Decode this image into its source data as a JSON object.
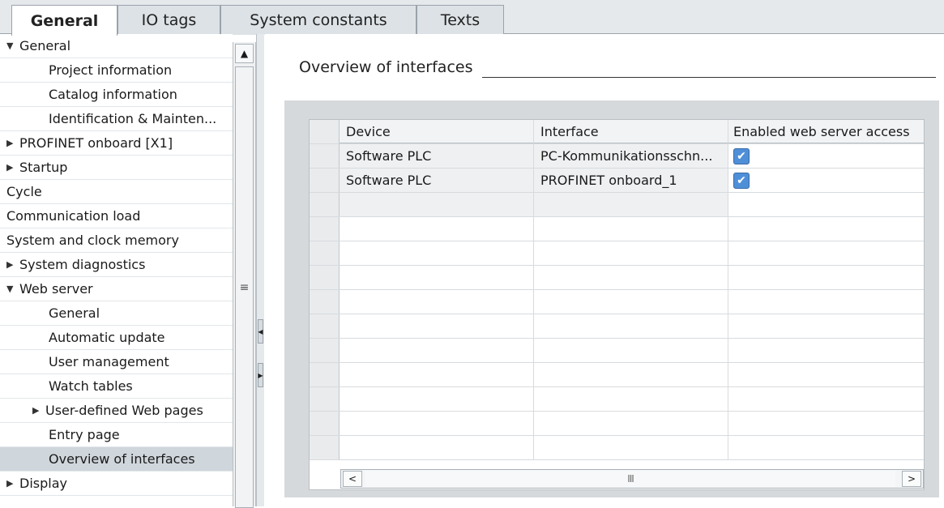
{
  "tabs": [
    {
      "label": "General",
      "active": true
    },
    {
      "label": "IO tags",
      "active": false
    },
    {
      "label": "System constants",
      "active": false
    },
    {
      "label": "Texts",
      "active": false
    }
  ],
  "tree": [
    {
      "label": "General",
      "expander": "▼",
      "selected": false
    },
    {
      "label": "Project information",
      "expander": "",
      "selected": false
    },
    {
      "label": "Catalog information",
      "expander": "",
      "selected": false
    },
    {
      "label": "Identification & Mainten...",
      "expander": "",
      "selected": false
    },
    {
      "label": "PROFINET onboard [X1]",
      "expander": "▶",
      "selected": false
    },
    {
      "label": "Startup",
      "expander": "▶",
      "selected": false
    },
    {
      "label": "Cycle",
      "expander": "",
      "selected": false
    },
    {
      "label": "Communication load",
      "expander": "",
      "selected": false
    },
    {
      "label": "System and clock memory",
      "expander": "",
      "selected": false
    },
    {
      "label": "System diagnostics",
      "expander": "▶",
      "selected": false
    },
    {
      "label": "Web server",
      "expander": "▼",
      "selected": false
    },
    {
      "label": "General",
      "expander": "",
      "selected": false
    },
    {
      "label": "Automatic update",
      "expander": "",
      "selected": false
    },
    {
      "label": "User management",
      "expander": "",
      "selected": false
    },
    {
      "label": "Watch tables",
      "expander": "",
      "selected": false
    },
    {
      "label": "User-defined Web pages",
      "expander": "▶",
      "selected": false
    },
    {
      "label": "Entry page",
      "expander": "",
      "selected": false
    },
    {
      "label": "Overview of interfaces",
      "expander": "",
      "selected": true
    },
    {
      "label": "Display",
      "expander": "▶",
      "selected": false
    }
  ],
  "main": {
    "section_title": "Overview of interfaces",
    "table": {
      "columns": [
        "Device",
        "Interface",
        "Enabled web server access"
      ],
      "rows": [
        {
          "device": "Software PLC",
          "interface": "PC-Kommunikationsschn...",
          "enabled": true
        },
        {
          "device": "Software PLC",
          "interface": "PROFINET onboard_1",
          "enabled": true
        }
      ]
    }
  },
  "icons": {
    "scroll_up": "▲",
    "scroll_grip": "≡",
    "collapse_left": "◀",
    "expand_right": "▶",
    "hscroll_left": "<",
    "hscroll_right": ">",
    "hscroll_grip": "III",
    "checkmark": "✔"
  },
  "colors": {
    "accent_checkbox": "#4f8fd8",
    "selected_row": "#cfd6dc",
    "panel_background": "#d6d9dc"
  }
}
